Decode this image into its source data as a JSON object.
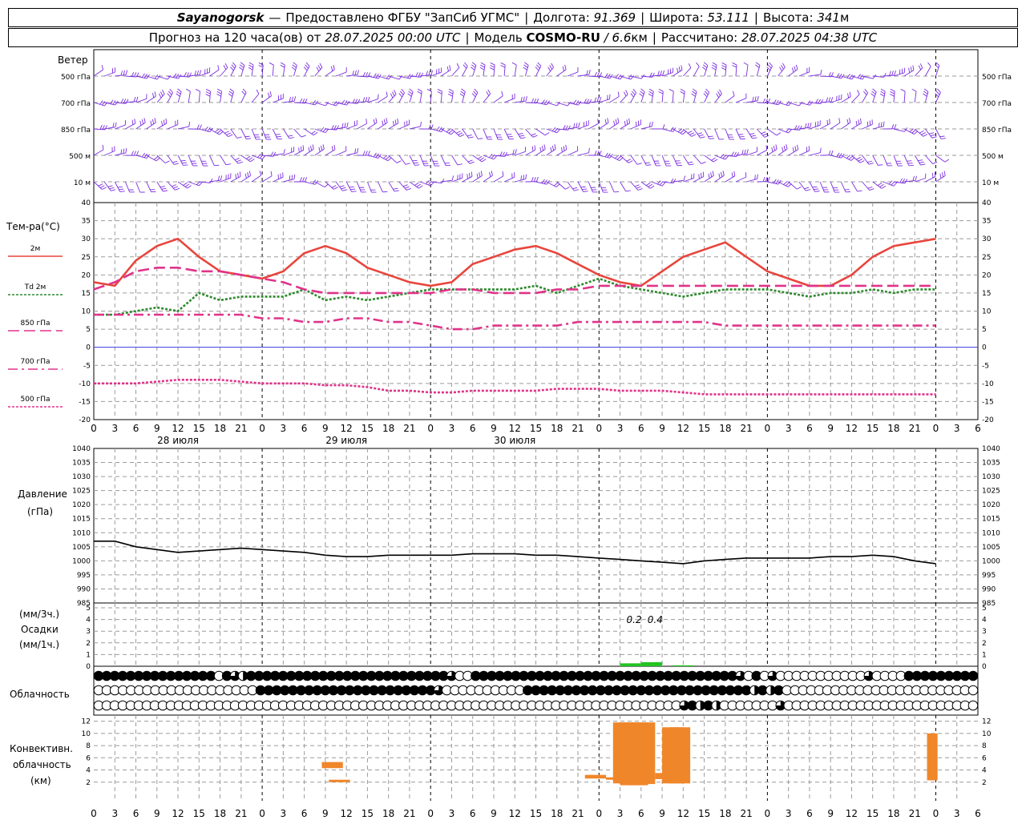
{
  "header": {
    "station": "Sayanogorsk",
    "dash": "—",
    "provider": "Предоставлено ФГБУ \"ЗапСиб УГМС\"",
    "lon_label": "Долгота:",
    "lon_value": "91.369",
    "lat_label": "Широта:",
    "lat_value": "53.111",
    "alt_label": "Высота:",
    "alt_value": "341",
    "alt_unit": "м",
    "forecast_label": "Прогноз на 120 часа(ов) от",
    "forecast_from": "28.07.2025 00:00 UTC",
    "model_label": "Модель",
    "model_name": "COSMO-RU",
    "model_res": "/ 6.6",
    "model_res_unit": "км",
    "calc_label": "Рассчитано:",
    "calc_time": "28.07.2025 04:38 UTC",
    "sep": "|"
  },
  "labels": {
    "wind": "Ветер",
    "temp": "Тем-ра(°C)",
    "pressure": "Давление",
    "pressure_unit": "(гПа)",
    "precip_unit1": "(мм/3ч.)",
    "precip": "Осадки",
    "precip_unit2": "(мм/1ч.)",
    "cloud": "Облачность",
    "conv1": "Конвективн.",
    "conv2": "облачность",
    "conv3": "(км)"
  },
  "chart_data": [
    {
      "type": "wind-barbs",
      "levels": [
        "500 гПа",
        "700 гПа",
        "850 гПа",
        "500 м",
        "10  м"
      ],
      "colors": {
        "barb": "#7b2ee0"
      }
    },
    {
      "type": "line",
      "title": "Тем-ра(°C)",
      "x_hours_from_start": [
        0,
        3,
        6,
        9,
        12,
        15,
        18,
        21,
        24,
        27,
        30,
        33,
        36,
        39,
        42,
        45,
        48,
        51,
        54,
        57,
        60,
        63,
        66,
        69,
        72,
        75,
        78,
        81,
        84,
        87,
        90,
        93,
        96,
        99,
        102,
        105,
        108,
        111,
        114,
        117,
        120
      ],
      "x_tick_labels": [
        "0",
        "3",
        "6",
        "9",
        "12",
        "15",
        "18",
        "21",
        "0",
        "3",
        "6",
        "9",
        "12",
        "15",
        "18",
        "21",
        "0",
        "3",
        "6",
        "9",
        "12",
        "15",
        "18",
        "21",
        "0",
        "3",
        "6",
        "9",
        "12",
        "15",
        "18",
        "21",
        "0",
        "3",
        "6",
        "9",
        "12",
        "15",
        "18",
        "21",
        "0",
        "3",
        "6"
      ],
      "day_labels": [
        "28 июля",
        "29 июля",
        "30 июля"
      ],
      "ylim": [
        -20,
        40
      ],
      "y_ticks": [
        40,
        35,
        30,
        25,
        20,
        15,
        10,
        5,
        0,
        -5,
        -10,
        -15,
        -20
      ],
      "series": [
        {
          "name": "2м",
          "color": "#e8453c",
          "style": "solid",
          "values": [
            18,
            17,
            24,
            28,
            30,
            25,
            21,
            20,
            19,
            21,
            26,
            28,
            26,
            22,
            20,
            18,
            17,
            18,
            23,
            25,
            27,
            28,
            26,
            23,
            20,
            18,
            17,
            21,
            25,
            27,
            29,
            25,
            21,
            19,
            17,
            17,
            20,
            25,
            28,
            29,
            30
          ]
        },
        {
          "name": "Td  2м",
          "color": "#2e8a2e",
          "style": "dotted",
          "values": [
            9,
            9,
            10,
            11,
            10,
            15,
            13,
            14,
            14,
            14,
            16,
            13,
            14,
            13,
            14,
            15,
            16,
            16,
            16,
            16,
            16,
            17,
            15,
            17,
            19,
            17,
            16,
            15,
            14,
            15,
            16,
            16,
            16,
            15,
            14,
            15,
            15,
            16,
            15,
            16,
            16
          ]
        },
        {
          "name": "850 гПа",
          "color": "#e0338a",
          "style": "dashed",
          "values": [
            16,
            18,
            21,
            22,
            22,
            21,
            21,
            20,
            19,
            18,
            16,
            15,
            15,
            15,
            15,
            15,
            15,
            16,
            16,
            15,
            15,
            15,
            16,
            16,
            17,
            17,
            17,
            17,
            17,
            17,
            17,
            17,
            17,
            17,
            17,
            17,
            17,
            17,
            17,
            17,
            17
          ]
        },
        {
          "name": "700 гПа",
          "color": "#e0338a",
          "style": "dashdot",
          "values": [
            9,
            9,
            9,
            9,
            9,
            9,
            9,
            9,
            8,
            8,
            7,
            7,
            8,
            8,
            7,
            7,
            6,
            5,
            5,
            6,
            6,
            6,
            6,
            7,
            7,
            7,
            7,
            7,
            7,
            7,
            6,
            6,
            6,
            6,
            6,
            6,
            6,
            6,
            6,
            6,
            6
          ]
        },
        {
          "name": "500 гПа",
          "color": "#e0338a",
          "style": "dotted",
          "values": [
            -10,
            -10,
            -10,
            -9.5,
            -9,
            -9,
            -9,
            -9.5,
            -10,
            -10,
            -10,
            -10.5,
            -10.5,
            -11,
            -12,
            -12,
            -12.5,
            -12.5,
            -12,
            -12,
            -12,
            -12,
            -11.5,
            -11.5,
            -11.5,
            -12,
            -12,
            -12,
            -12.5,
            -13,
            -13,
            -13,
            -13,
            -13,
            -13,
            -13,
            -13,
            -13,
            -13,
            -13,
            -13
          ]
        }
      ]
    },
    {
      "type": "line",
      "title": "Давление",
      "ylabel": "(гПа)",
      "ylim": [
        985,
        1040
      ],
      "y_ticks": [
        1040,
        1035,
        1030,
        1025,
        1020,
        1015,
        1010,
        1005,
        1000,
        995,
        990,
        985
      ],
      "series": [
        {
          "name": "",
          "color": "#000000",
          "values": [
            1007,
            1007,
            1005,
            1004,
            1003,
            1003.5,
            1004,
            1004.5,
            1004,
            1003.5,
            1003,
            1002,
            1001.5,
            1001.5,
            1002,
            1002,
            1002,
            1002,
            1002.5,
            1002.5,
            1002.5,
            1002,
            1002,
            1001.5,
            1001,
            1000.5,
            1000,
            999.5,
            999,
            1000,
            1000.5,
            1001,
            1001,
            1001,
            1001,
            1001.5,
            1001.5,
            1002,
            1001.5,
            1000,
            999
          ]
        }
      ]
    },
    {
      "type": "bar",
      "title": "Осадки",
      "ylim": [
        0,
        5
      ],
      "y_ticks": [
        5,
        4,
        3,
        2,
        1,
        0
      ],
      "annotations": [
        "0.2",
        "0.4"
      ],
      "bars": [
        {
          "x_hour": 76.5,
          "value": 0.25
        },
        {
          "x_hour": 79.5,
          "value": 0.35
        },
        {
          "x_hour": 84,
          "value": 0.08
        }
      ],
      "color": "#22c422"
    },
    {
      "type": "cloud-symbols",
      "title": "Облачность",
      "rows": [
        "FFFFFFFFFFFFFFFEF35FFFFFFFFFFFFFFFFFFFFFFFFF3EEFFFFFFFFFFFFFFFFFFFFFFFFFFFFFFFFF3EFE3EEEEEEEEEEE3EEEEFFFFFFFFF",
        "EEEEEEEEEEEEEEEEEEEEFFFFFFFFFFFFFFFFFFFFFF3EEEEEEEEEEFFFFFFFFFFFFFFFFFFFFFFFFFFFF5F5FEEEEEEEEEEEEEEEEEEEEEEEE",
        "EEEEEEEEEEEEEEEEEEEEEEEEEEEEEEEEEEEEEEEEEEEEEEEEEEEEEEEEEEEEEEEEEEEEEEEEE3F5F5EEEEEEE3EEEEEEEEEEEEEEEEEEEEEEEE"
      ]
    },
    {
      "type": "range-bar",
      "title": "Конвективн. облачность",
      "ylabel": "(км)",
      "ylim": [
        0,
        13
      ],
      "y_ticks": [
        12,
        10,
        8,
        6,
        4,
        2
      ],
      "color": "#f0862a",
      "bars": [
        {
          "x_hour": 34.0,
          "width_h": 1.0,
          "bottom": 4.3,
          "top": 5.3
        },
        {
          "x_hour": 35.0,
          "width_h": 1.0,
          "bottom": 2.0,
          "top": 2.4
        },
        {
          "x_hour": 71.5,
          "width_h": 1.0,
          "bottom": 2.6,
          "top": 3.2
        },
        {
          "x_hour": 74.5,
          "width_h": 1.0,
          "bottom": 2.4,
          "top": 2.8
        },
        {
          "x_hour": 75.5,
          "width_h": 1.0,
          "bottom": 1.8,
          "top": 11.8
        },
        {
          "x_hour": 76.5,
          "width_h": 1.0,
          "bottom": 1.5,
          "top": 11.8
        },
        {
          "x_hour": 77.5,
          "width_h": 1.0,
          "bottom": 1.5,
          "top": 11.8
        },
        {
          "x_hour": 78.5,
          "width_h": 1.0,
          "bottom": 1.7,
          "top": 11.8
        },
        {
          "x_hour": 81.5,
          "width_h": 1.0,
          "bottom": 2.5,
          "top": 3.5
        },
        {
          "x_hour": 82.5,
          "width_h": 1.0,
          "bottom": 1.8,
          "top": 11.0
        },
        {
          "x_hour": 83.5,
          "width_h": 1.0,
          "bottom": 1.8,
          "top": 11.0
        },
        {
          "x_hour": 119.5,
          "width_h": 0.5,
          "bottom": 2.3,
          "top": 10.0
        }
      ]
    }
  ]
}
